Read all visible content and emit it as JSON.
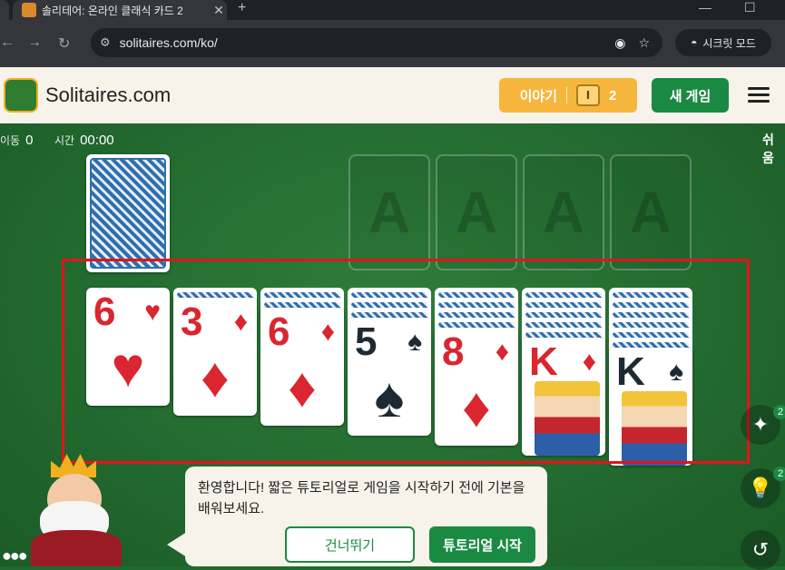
{
  "browser": {
    "tab_title": "솔리테어: 온라인 클래식 카드 2",
    "tab_close": "✕",
    "new_tab": "+",
    "url": "solitaires.com/ko/",
    "incognito_label": "시크릿 모드"
  },
  "header": {
    "brand": "Solitaires.com",
    "story_label": "이야기",
    "story_badge": "Ⅰ",
    "story_count": "2",
    "new_game_label": "새 게임"
  },
  "stats": {
    "moves_label": "이동",
    "moves_value": "0",
    "time_label": "시간",
    "time_value": "00:00",
    "difficulty": "쉬움"
  },
  "foundations": [
    "A",
    "A",
    "A",
    "A"
  ],
  "tableau": [
    {
      "rank": "6",
      "suit": "♥",
      "color": "red",
      "hidden": 0
    },
    {
      "rank": "3",
      "suit": "♦",
      "color": "red",
      "hidden": 1
    },
    {
      "rank": "6",
      "suit": "♦",
      "color": "red",
      "hidden": 2
    },
    {
      "rank": "5",
      "suit": "♠",
      "color": "black",
      "hidden": 3
    },
    {
      "rank": "8",
      "suit": "♦",
      "color": "red",
      "hidden": 4
    },
    {
      "rank": "K",
      "suit": "♦",
      "color": "red",
      "hidden": 5
    },
    {
      "rank": "K",
      "suit": "♠",
      "color": "black",
      "hidden": 6
    }
  ],
  "side": {
    "magic_count": "2",
    "hint_count": "2",
    "magic_icon": "magic-wand-icon",
    "hint_icon": "lightbulb-icon",
    "undo_icon": "undo-icon"
  },
  "tutorial": {
    "text": "환영합니다! 짧은 튜토리얼로 게임을 시작하기 전에 기본을 배워보세요.",
    "skip_label": "건너뛰기",
    "start_label": "튜토리얼 시작"
  },
  "colors": {
    "brand_green": "#1a8a43",
    "story_orange": "#f6b53d",
    "highlight_red": "#e3141b",
    "felt_green": "#22692f"
  }
}
